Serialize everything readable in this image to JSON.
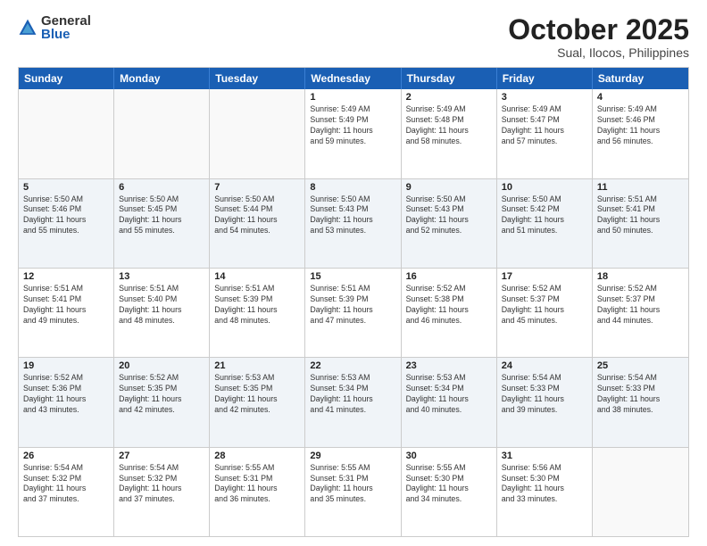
{
  "logo": {
    "general": "General",
    "blue": "Blue"
  },
  "title": "October 2025",
  "location": "Sual, Ilocos, Philippines",
  "weekdays": [
    "Sunday",
    "Monday",
    "Tuesday",
    "Wednesday",
    "Thursday",
    "Friday",
    "Saturday"
  ],
  "weeks": [
    [
      {
        "date": "",
        "info": ""
      },
      {
        "date": "",
        "info": ""
      },
      {
        "date": "",
        "info": ""
      },
      {
        "date": "1",
        "info": "Sunrise: 5:49 AM\nSunset: 5:49 PM\nDaylight: 11 hours\nand 59 minutes."
      },
      {
        "date": "2",
        "info": "Sunrise: 5:49 AM\nSunset: 5:48 PM\nDaylight: 11 hours\nand 58 minutes."
      },
      {
        "date": "3",
        "info": "Sunrise: 5:49 AM\nSunset: 5:47 PM\nDaylight: 11 hours\nand 57 minutes."
      },
      {
        "date": "4",
        "info": "Sunrise: 5:49 AM\nSunset: 5:46 PM\nDaylight: 11 hours\nand 56 minutes."
      }
    ],
    [
      {
        "date": "5",
        "info": "Sunrise: 5:50 AM\nSunset: 5:46 PM\nDaylight: 11 hours\nand 55 minutes."
      },
      {
        "date": "6",
        "info": "Sunrise: 5:50 AM\nSunset: 5:45 PM\nDaylight: 11 hours\nand 55 minutes."
      },
      {
        "date": "7",
        "info": "Sunrise: 5:50 AM\nSunset: 5:44 PM\nDaylight: 11 hours\nand 54 minutes."
      },
      {
        "date": "8",
        "info": "Sunrise: 5:50 AM\nSunset: 5:43 PM\nDaylight: 11 hours\nand 53 minutes."
      },
      {
        "date": "9",
        "info": "Sunrise: 5:50 AM\nSunset: 5:43 PM\nDaylight: 11 hours\nand 52 minutes."
      },
      {
        "date": "10",
        "info": "Sunrise: 5:50 AM\nSunset: 5:42 PM\nDaylight: 11 hours\nand 51 minutes."
      },
      {
        "date": "11",
        "info": "Sunrise: 5:51 AM\nSunset: 5:41 PM\nDaylight: 11 hours\nand 50 minutes."
      }
    ],
    [
      {
        "date": "12",
        "info": "Sunrise: 5:51 AM\nSunset: 5:41 PM\nDaylight: 11 hours\nand 49 minutes."
      },
      {
        "date": "13",
        "info": "Sunrise: 5:51 AM\nSunset: 5:40 PM\nDaylight: 11 hours\nand 48 minutes."
      },
      {
        "date": "14",
        "info": "Sunrise: 5:51 AM\nSunset: 5:39 PM\nDaylight: 11 hours\nand 48 minutes."
      },
      {
        "date": "15",
        "info": "Sunrise: 5:51 AM\nSunset: 5:39 PM\nDaylight: 11 hours\nand 47 minutes."
      },
      {
        "date": "16",
        "info": "Sunrise: 5:52 AM\nSunset: 5:38 PM\nDaylight: 11 hours\nand 46 minutes."
      },
      {
        "date": "17",
        "info": "Sunrise: 5:52 AM\nSunset: 5:37 PM\nDaylight: 11 hours\nand 45 minutes."
      },
      {
        "date": "18",
        "info": "Sunrise: 5:52 AM\nSunset: 5:37 PM\nDaylight: 11 hours\nand 44 minutes."
      }
    ],
    [
      {
        "date": "19",
        "info": "Sunrise: 5:52 AM\nSunset: 5:36 PM\nDaylight: 11 hours\nand 43 minutes."
      },
      {
        "date": "20",
        "info": "Sunrise: 5:52 AM\nSunset: 5:35 PM\nDaylight: 11 hours\nand 42 minutes."
      },
      {
        "date": "21",
        "info": "Sunrise: 5:53 AM\nSunset: 5:35 PM\nDaylight: 11 hours\nand 42 minutes."
      },
      {
        "date": "22",
        "info": "Sunrise: 5:53 AM\nSunset: 5:34 PM\nDaylight: 11 hours\nand 41 minutes."
      },
      {
        "date": "23",
        "info": "Sunrise: 5:53 AM\nSunset: 5:34 PM\nDaylight: 11 hours\nand 40 minutes."
      },
      {
        "date": "24",
        "info": "Sunrise: 5:54 AM\nSunset: 5:33 PM\nDaylight: 11 hours\nand 39 minutes."
      },
      {
        "date": "25",
        "info": "Sunrise: 5:54 AM\nSunset: 5:33 PM\nDaylight: 11 hours\nand 38 minutes."
      }
    ],
    [
      {
        "date": "26",
        "info": "Sunrise: 5:54 AM\nSunset: 5:32 PM\nDaylight: 11 hours\nand 37 minutes."
      },
      {
        "date": "27",
        "info": "Sunrise: 5:54 AM\nSunset: 5:32 PM\nDaylight: 11 hours\nand 37 minutes."
      },
      {
        "date": "28",
        "info": "Sunrise: 5:55 AM\nSunset: 5:31 PM\nDaylight: 11 hours\nand 36 minutes."
      },
      {
        "date": "29",
        "info": "Sunrise: 5:55 AM\nSunset: 5:31 PM\nDaylight: 11 hours\nand 35 minutes."
      },
      {
        "date": "30",
        "info": "Sunrise: 5:55 AM\nSunset: 5:30 PM\nDaylight: 11 hours\nand 34 minutes."
      },
      {
        "date": "31",
        "info": "Sunrise: 5:56 AM\nSunset: 5:30 PM\nDaylight: 11 hours\nand 33 minutes."
      },
      {
        "date": "",
        "info": ""
      }
    ]
  ]
}
